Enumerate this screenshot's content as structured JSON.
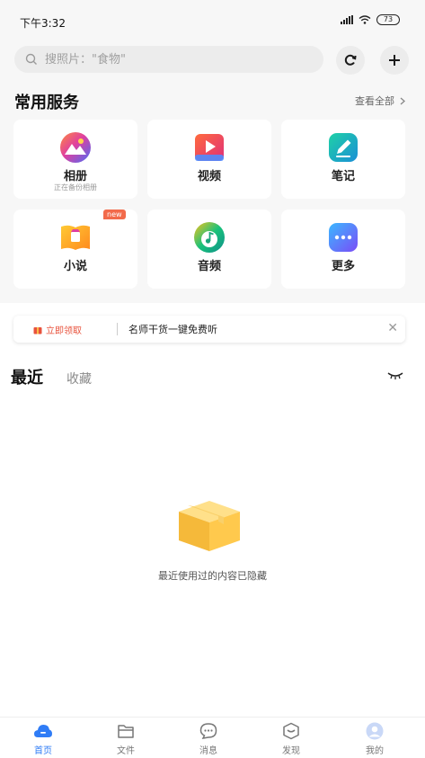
{
  "status": {
    "time": "下午3:32",
    "battery": "73"
  },
  "search": {
    "placeholder": "搜照片：\"食物\""
  },
  "services": {
    "title": "常用服务",
    "view_all": "查看全部",
    "items": [
      {
        "label": "相册",
        "sub": "正在备份相册",
        "icon": "photos-icon"
      },
      {
        "label": "视频",
        "icon": "video-icon"
      },
      {
        "label": "笔记",
        "icon": "notes-icon"
      },
      {
        "label": "小说",
        "badge": "new",
        "icon": "novel-icon"
      },
      {
        "label": "音频",
        "icon": "audio-icon"
      },
      {
        "label": "更多",
        "icon": "more-icon"
      }
    ]
  },
  "banner": {
    "claim": "立即领取",
    "text": "名师干货一键免费听"
  },
  "recent": {
    "tab_recent": "最近",
    "tab_favorites": "收藏",
    "empty_text": "最近使用过的内容已隐藏"
  },
  "nav": {
    "items": [
      {
        "label": "首页",
        "active": true
      },
      {
        "label": "文件"
      },
      {
        "label": "消息"
      },
      {
        "label": "发现"
      },
      {
        "label": "我的"
      }
    ]
  },
  "colors": {
    "accent": "#2f7cf6",
    "claim": "#e8523c",
    "badge": "#f26a4b"
  }
}
